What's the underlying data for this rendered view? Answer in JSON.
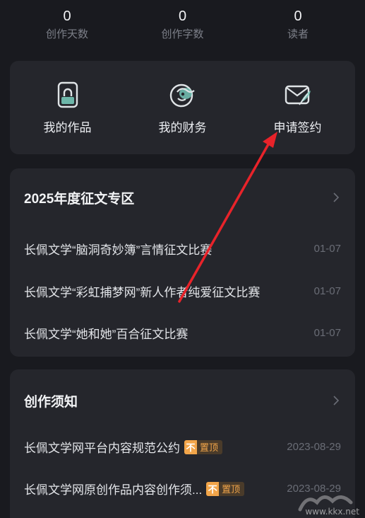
{
  "stats": [
    {
      "value": "0",
      "label": "创作天数"
    },
    {
      "value": "0",
      "label": "创作字数"
    },
    {
      "value": "0",
      "label": "读者"
    }
  ],
  "shortcuts": [
    {
      "label": "我的作品",
      "icon": "works-book-icon"
    },
    {
      "label": "我的财务",
      "icon": "finance-icon"
    },
    {
      "label": "申请签约",
      "icon": "contract-envelope-icon"
    }
  ],
  "contest": {
    "title": "2025年度征文专区",
    "items": [
      {
        "text": "长佩文学“脑洞奇妙簿”言情征文比赛",
        "date": "01-07"
      },
      {
        "text": "长佩文学“彩虹捕梦网”新人作者纯爱征文比赛",
        "date": "01-07"
      },
      {
        "text": "长佩文学“她和她”百合征文比赛",
        "date": "01-07"
      }
    ]
  },
  "notice": {
    "title": "创作须知",
    "pin_icon_text": "不",
    "items": [
      {
        "text": "长佩文学网平台内容规范公约",
        "pin": "置顶",
        "date": "2023-08-29"
      },
      {
        "text": "长佩文学网原创作品内容创作须...",
        "pin": "置顶",
        "date": "2023-08-29"
      }
    ]
  },
  "annotation": {
    "type": "red-arrow",
    "target": "申请签约",
    "color": "#e8232a"
  },
  "watermark": {
    "text": "www.kkx.net"
  },
  "colors": {
    "background": "#191a1f",
    "card": "#25262c",
    "pin_accent": "#f2a54a",
    "icon_teal": "#7ad0c0"
  }
}
